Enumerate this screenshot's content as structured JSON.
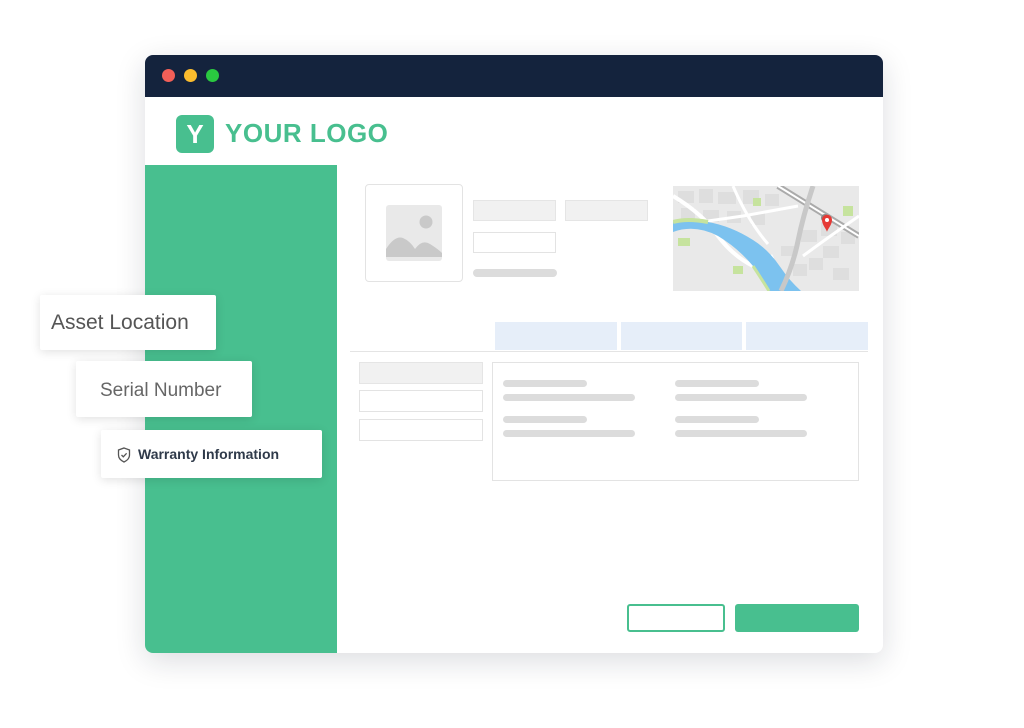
{
  "window": {
    "controls": [
      "close",
      "minimize",
      "maximize"
    ],
    "colors": {
      "titlebar": "#14233d",
      "close": "#f25f58",
      "minimize": "#fbbc2e",
      "maximize": "#2ac840",
      "accent": "#48bf8f"
    }
  },
  "logo": {
    "mark": "Y",
    "text": "YOUR LOGO"
  },
  "cards": {
    "asset_location": "Asset Location",
    "serial_number": "Serial Number",
    "warranty_information": "Warranty Information"
  },
  "icons": {
    "image": "image-placeholder-icon",
    "map_pin": "map-pin-icon",
    "shield": "shield-check-icon"
  }
}
